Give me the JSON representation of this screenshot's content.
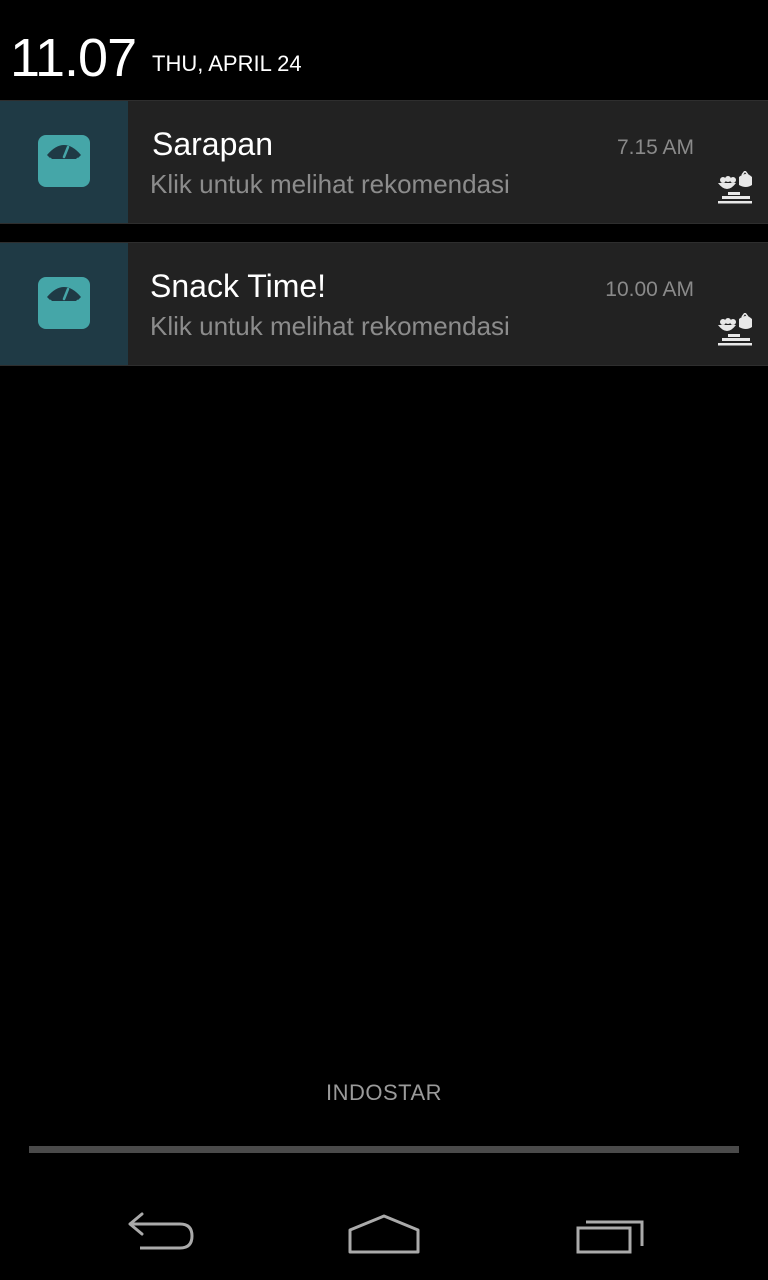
{
  "status": {
    "time": "11.07",
    "date": "THU, APRIL 24"
  },
  "notifications": [
    {
      "title": "Sarapan",
      "time": "7.15 AM",
      "text": "Klik untuk melihat rekomendasi",
      "icon": "scale-icon",
      "small_icon": "food-icon"
    },
    {
      "title": "Snack Time!",
      "time": "10.00 AM",
      "text": "Klik untuk melihat rekomendasi",
      "icon": "scale-icon",
      "small_icon": "food-icon"
    }
  ],
  "carrier": "INDOSTAR",
  "navbar": {
    "back_icon": "back-icon",
    "home_icon": "home-icon",
    "recent_icon": "recent-apps-icon"
  },
  "colors": {
    "icon_accent": "#45a6a8",
    "icon_bg": "#1f3a45",
    "notification_bg": "#222222"
  }
}
